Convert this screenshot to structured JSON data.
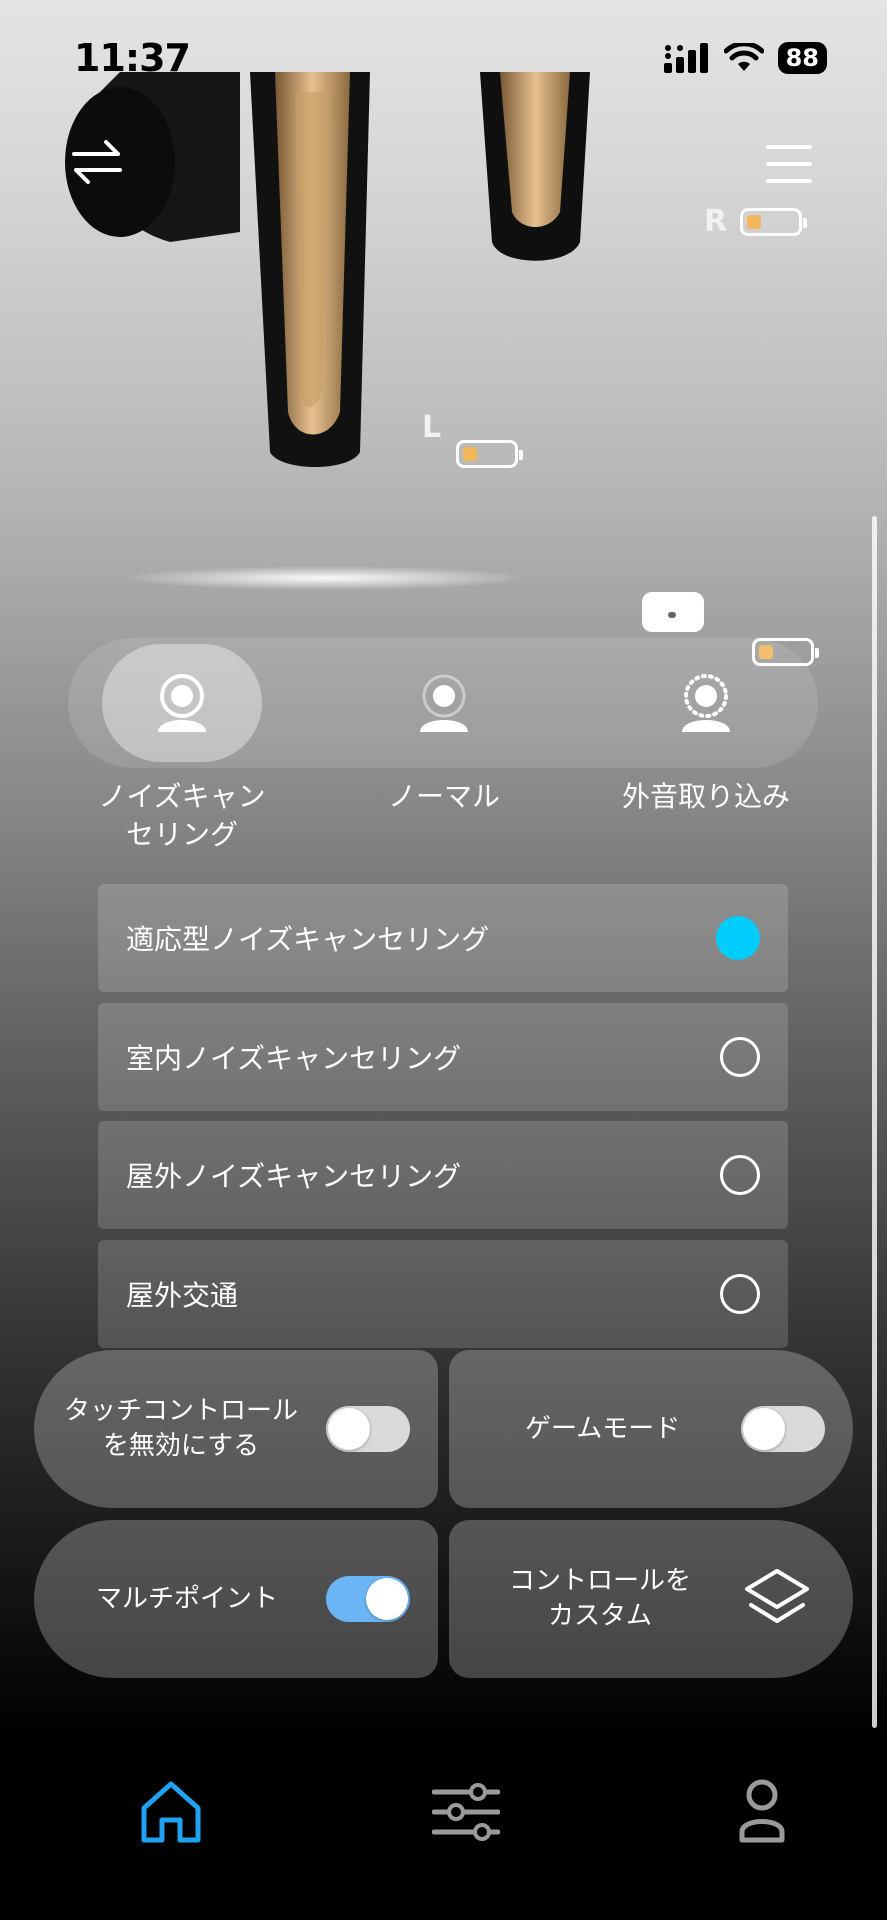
{
  "status_bar": {
    "time": "11:37",
    "battery": "88"
  },
  "earbuds": {
    "right_label": "R",
    "left_label": "L",
    "right_battery_level": 0.25,
    "left_battery_level": 0.25,
    "case_battery_level": 0.25
  },
  "header": {
    "switch_icon": "swap-arrows-icon",
    "menu_icon": "hamburger-menu-icon"
  },
  "modes": [
    {
      "label": "ノイズキャンセリング",
      "line1": "ノイズキャン",
      "line2": "セリング",
      "icon": "person-anc-icon",
      "selected": true
    },
    {
      "label": "ノーマル",
      "icon": "person-normal-icon",
      "selected": false
    },
    {
      "label": "外音取り込み",
      "icon": "person-ambient-icon",
      "selected": false
    }
  ],
  "anc_options": [
    {
      "label": "適応型ノイズキャンセリング",
      "selected": true
    },
    {
      "label": "室内ノイズキャンセリング",
      "selected": false
    },
    {
      "label": "屋外ノイズキャンセリング",
      "selected": false
    },
    {
      "label": "屋外交通",
      "selected": false
    }
  ],
  "tiles": {
    "touch_control": {
      "line1": "タッチコントロール",
      "line2": "を無効にする",
      "enabled": false
    },
    "game_mode": {
      "label": "ゲームモード",
      "enabled": false
    },
    "multipoint": {
      "label": "マルチポイント",
      "enabled": true
    },
    "custom_control": {
      "line1": "コントロールを",
      "line2": "カスタム",
      "icon": "layers-icon"
    }
  },
  "tab_bar": [
    {
      "icon": "home-icon",
      "active": true
    },
    {
      "icon": "equalizer-sliders-icon",
      "active": false
    },
    {
      "icon": "profile-icon",
      "active": false
    }
  ],
  "colors": {
    "accent": "#00cdfb",
    "toggle_on": "#6cb5f4",
    "active_tab": "#1fa3f0",
    "battery_fill": "#f4b65b"
  }
}
